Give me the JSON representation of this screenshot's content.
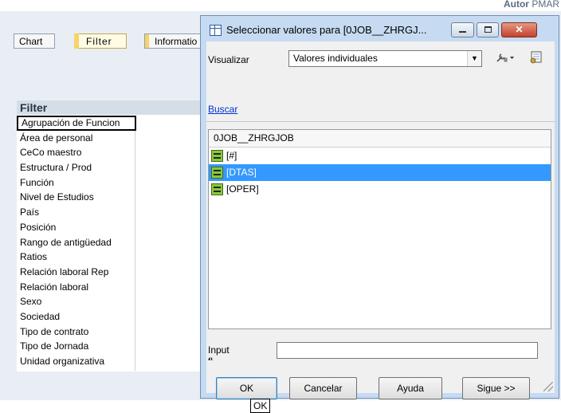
{
  "app": {
    "author_label": "Autor",
    "author_user": "PMAR",
    "tabs": [
      {
        "label": "Chart"
      },
      {
        "label": "Filter"
      },
      {
        "label": "Informatio"
      }
    ]
  },
  "filter_panel": {
    "title": "Filter",
    "items": [
      "Agrupación de Funcion",
      "Área de personal",
      "CeCo maestro",
      "Estructura / Prod",
      "Función",
      "Nivel de Estudios",
      "País",
      "Posición",
      "Rango de antigüedad",
      "Ratios",
      "Relación laboral Rep",
      "Relación laboral",
      "Sexo",
      "Sociedad",
      "Tipo de contrato",
      "Tipo de Jornada",
      "Unidad organizativa"
    ]
  },
  "dialog": {
    "title": "Seleccionar valores para [0JOB__ZHRGJ...",
    "visualizar_label": "Visualizar",
    "visualizar_value": "Valores individuales",
    "buscar_link": "Buscar",
    "list_header": "0JOB__ZHRGJOB",
    "rows": [
      {
        "label": "[#]",
        "selected": false
      },
      {
        "label": "[DTAS]",
        "selected": true
      },
      {
        "label": "[OPER]",
        "selected": false
      }
    ],
    "input_label": "Input",
    "input_label_cut": "fl...",
    "input_value": "",
    "buttons": {
      "ok": "OK",
      "cancel": "Cancelar",
      "help": "Ayuda",
      "next": "Sigue >>"
    }
  },
  "tooltip": "OK",
  "colors": {
    "selection": "#3399ff",
    "dialog_frame": "#c6daf2",
    "value_icon": "#8cc63f"
  },
  "icons": {
    "title": "window-table-icon",
    "tools": "wrench-dropdown-icon",
    "settings": "settings-grid-icon",
    "value": "equals-value-icon"
  }
}
